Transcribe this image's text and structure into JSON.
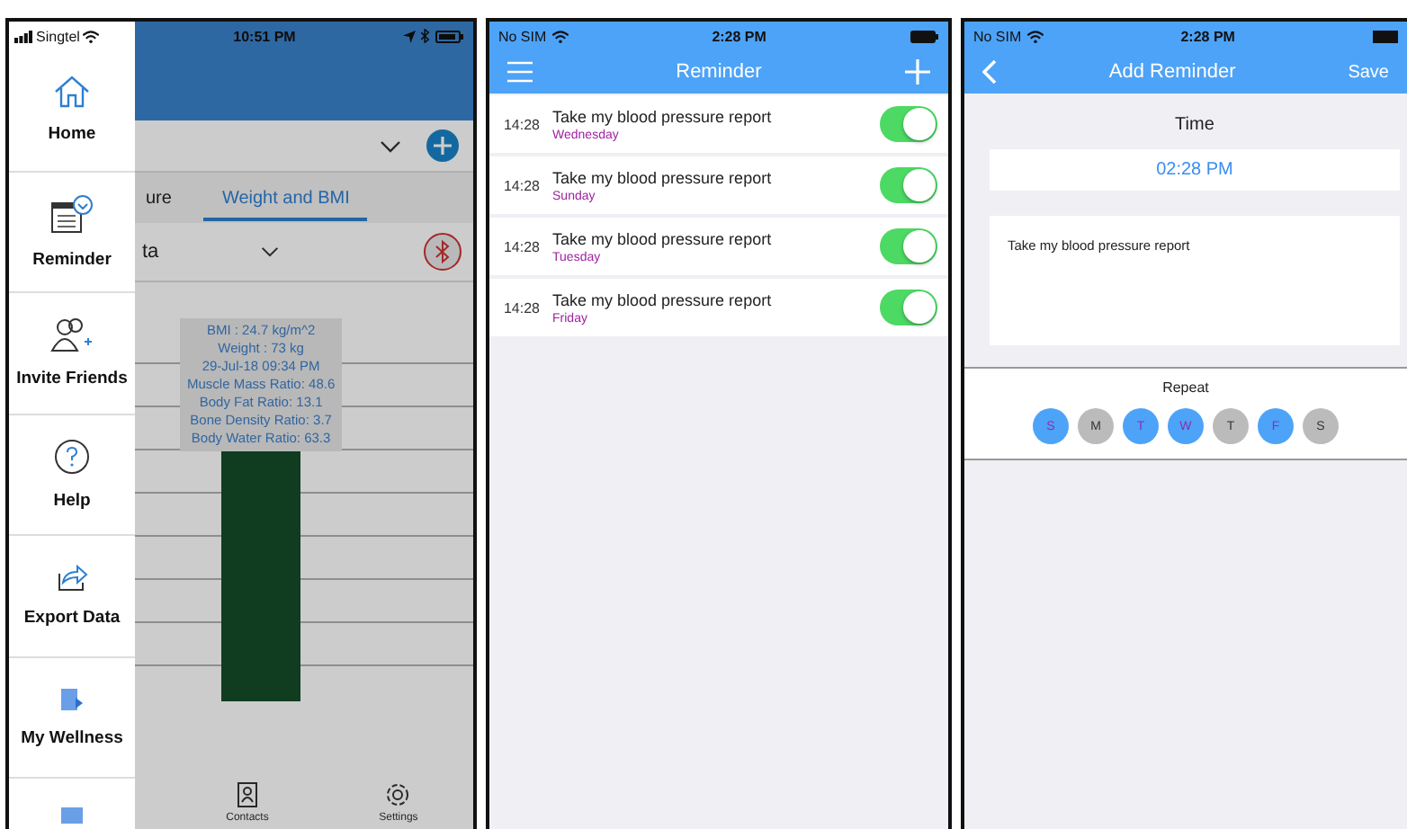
{
  "home_screen": {
    "status_bar": {
      "carrier": "Singtel",
      "time": "10:51 PM"
    },
    "drawer": [
      {
        "label": "Home"
      },
      {
        "label": "Reminder"
      },
      {
        "label": "Invite Friends"
      },
      {
        "label": "Help"
      },
      {
        "label": "Export Data"
      },
      {
        "label": "My Wellness"
      }
    ],
    "tabs": [
      {
        "label": "ure",
        "selected": false
      },
      {
        "label": "Weight and BMI",
        "selected": true
      }
    ],
    "selector": "ta",
    "tooltip": [
      "BMI : 24.7 kg/m^2",
      "Weight : 73 kg",
      "29-Jul-18 09:34 PM",
      "Muscle Mass Ratio: 48.6",
      "Body Fat Ratio: 13.1",
      "Bone Density Ratio: 3.7",
      "Body Water Ratio: 63.3"
    ],
    "bottom_nav": [
      {
        "label": "Contacts"
      },
      {
        "label": "Settings"
      }
    ]
  },
  "reminder_screen": {
    "status_bar": {
      "carrier": "No SIM",
      "time": "2:28 PM"
    },
    "title": "Reminder",
    "reminders": [
      {
        "time": "14:28",
        "text": "Take my blood pressure report",
        "day": "Wednesday",
        "on": true
      },
      {
        "time": "14:28",
        "text": "Take my blood pressure report",
        "day": "Sunday",
        "on": true
      },
      {
        "time": "14:28",
        "text": "Take my blood pressure report",
        "day": "Tuesday",
        "on": true
      },
      {
        "time": "14:28",
        "text": "Take my blood pressure report",
        "day": "Friday",
        "on": true
      }
    ]
  },
  "add_reminder_screen": {
    "status_bar": {
      "carrier": "No SIM",
      "time": "2:28 PM"
    },
    "title": "Add Reminder",
    "save": "Save",
    "time_label": "Time",
    "time_value": "02:28 PM",
    "note": "Take my blood pressure report",
    "repeat_label": "Repeat",
    "days": [
      {
        "label": "S",
        "selected": true
      },
      {
        "label": "M",
        "selected": false
      },
      {
        "label": "T",
        "selected": true
      },
      {
        "label": "W",
        "selected": true
      },
      {
        "label": "T",
        "selected": false
      },
      {
        "label": "F",
        "selected": true
      },
      {
        "label": "S",
        "selected": false
      }
    ]
  }
}
